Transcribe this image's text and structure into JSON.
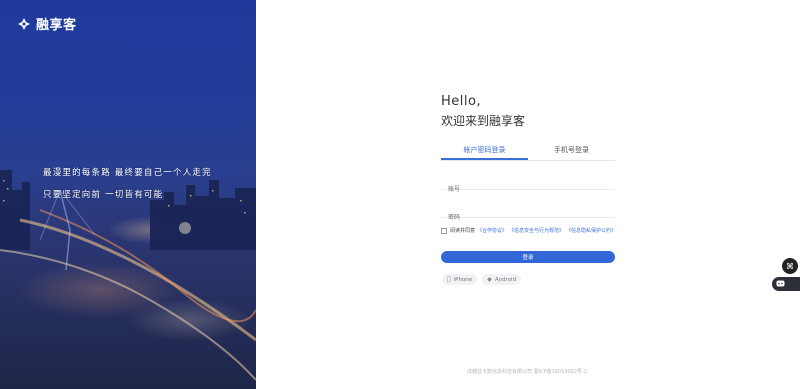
{
  "brand": {
    "name": "融享客"
  },
  "slogan": {
    "line1": "最漫里的每条路 最终要自己一个人走完",
    "line2": "只要坚定向前 一切皆有可能"
  },
  "greeting": {
    "line1": "Hello,",
    "line2": "欢迎来到融享客"
  },
  "tabs": [
    {
      "label": "帐户密码登录",
      "active": true
    },
    {
      "label": "手机号登录",
      "active": false
    }
  ],
  "form": {
    "account_placeholder": "账号",
    "password_placeholder": "密码"
  },
  "agreement": {
    "prefix": "阅读并同意",
    "links": [
      "《合作协议》",
      "《信息安全与行为规范》",
      "《信息隐私保护公约》"
    ],
    "checked": false
  },
  "login_button": "登录",
  "downloads": [
    {
      "label": "iPhone",
      "icon": "apple-icon"
    },
    {
      "label": "Android",
      "icon": "android-icon"
    }
  ],
  "footer": "成都任卡数信息科技有限公司 蜀ICP备19019022号-2",
  "colors": {
    "accent": "#3366d6",
    "left_panel": "#233d99"
  }
}
